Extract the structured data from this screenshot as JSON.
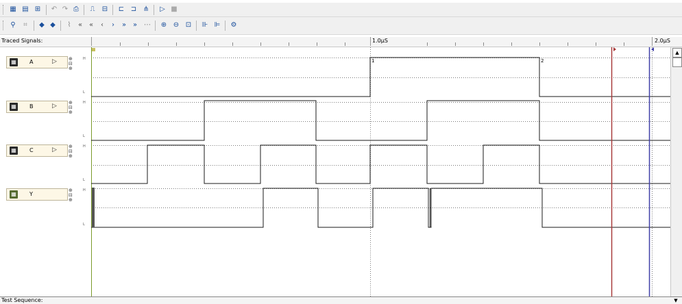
{
  "toolbar1": {
    "icons": [
      "new-simulation-icon",
      "open-file-icon",
      "save-tree-icon",
      "undo-icon",
      "redo-icon",
      "print-icon",
      "add-trace-icon",
      "configure-icon",
      "import-icon",
      "export-icon",
      "tree-icon",
      "play-icon",
      "stop-icon"
    ]
  },
  "toolbar2": {
    "icons": [
      "add-signal-icon",
      "grid-icon",
      "previous-icon",
      "next-icon",
      "zoom-bar-icon",
      "jump-start-icon",
      "step-back-fast-icon",
      "step-back-icon",
      "step-forward-icon",
      "step-forward-fast-icon",
      "jump-end-icon",
      "fit-icon",
      "zoom-in-icon",
      "zoom-out-icon",
      "zoom-fit-icon",
      "sim-start-icon",
      "sim-end-icon",
      "settings-icon"
    ],
    "glyphs": {
      "jump-start-icon": "«",
      "step-back-fast-icon": "«",
      "step-back-icon": "‹",
      "step-forward-icon": "›",
      "step-forward-fast-icon": "»",
      "jump-end-icon": "»"
    }
  },
  "header": {
    "traced_signals_label": "Traced Signals:",
    "time_labels": [
      "1.0µS",
      "2.0µS"
    ]
  },
  "signals": [
    {
      "name": "A",
      "icon": "input-signal-icon",
      "high_label": "H",
      "low_label": "L"
    },
    {
      "name": "B",
      "icon": "input-signal-icon",
      "high_label": "H",
      "low_label": "L"
    },
    {
      "name": "C",
      "icon": "input-signal-icon",
      "high_label": "H",
      "low_label": "L"
    },
    {
      "name": "Y",
      "icon": "output-signal-icon",
      "high_label": "H",
      "low_label": "L"
    }
  ],
  "markers": {
    "label_1": "1",
    "label_2": "2"
  },
  "test_sequence": {
    "label": "Test Sequence:"
  },
  "colors": {
    "cursor_red": "#a83a3a",
    "cursor_blue": "#4040a8",
    "trace": "#1a1a1a",
    "grid": "#888888"
  }
}
